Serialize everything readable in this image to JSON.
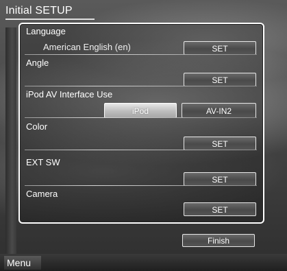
{
  "title": "Initial SETUP",
  "rows": [
    {
      "title": "Language",
      "value": "American English (en)",
      "button": "SET"
    },
    {
      "title": "Angle",
      "button": "SET"
    },
    {
      "title": "iPod AV Interface Use",
      "option_a": "iPod",
      "option_b": "AV-IN2",
      "selected": "iPod"
    },
    {
      "title": "Color",
      "button": "SET"
    },
    {
      "title": "EXT SW",
      "button": "SET"
    },
    {
      "title": "Camera",
      "button": "SET"
    }
  ],
  "finish_label": "Finish",
  "menu_label": "Menu"
}
